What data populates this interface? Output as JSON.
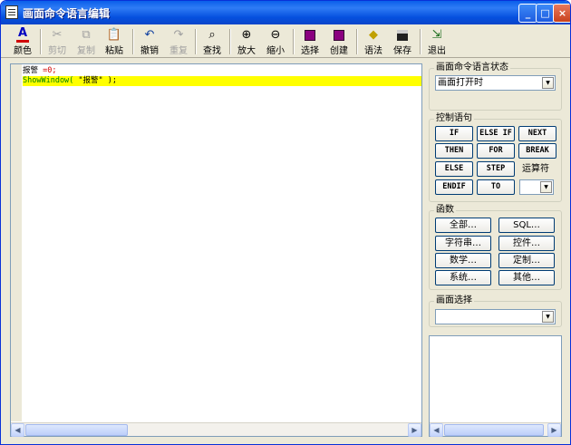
{
  "window": {
    "title": "画面命令语言编辑",
    "buttons": {
      "minimize": "_",
      "maximize": "□",
      "close": "×"
    }
  },
  "toolbar": {
    "color": "颜色",
    "cut": "剪切",
    "copy": "复制",
    "paste": "粘贴",
    "undo": "撤销",
    "redo": "重复",
    "find": "查找",
    "zoom_in": "放大",
    "zoom_out": "缩小",
    "select": "选择",
    "create": "创建",
    "syntax": "语法",
    "save": "保存",
    "exit": "退出"
  },
  "editor": {
    "lines": [
      {
        "parts": [
          "报警",
          " =0;"
        ]
      },
      {
        "parts": [
          "ShowWindow(",
          " \"报警\"",
          " );"
        ]
      }
    ]
  },
  "status_group": {
    "title": "画面命令语言状态",
    "selected": "画面打开时"
  },
  "control_group": {
    "title": "控制语句",
    "buttons": [
      "IF",
      "ELSE IF",
      "NEXT",
      "THEN",
      "FOR",
      "BREAK",
      "ELSE",
      "STEP",
      "ENDIF",
      "TO"
    ],
    "operator_label": "运算符",
    "operator_value": ""
  },
  "function_group": {
    "title": "函数",
    "buttons": [
      "全部…",
      "SQL…",
      "字符串…",
      "控件…",
      "数学…",
      "定制…",
      "系统…",
      "其他…"
    ]
  },
  "screen_group": {
    "title": "画面选择",
    "selected": ""
  },
  "colors": {
    "titlebar": "#0A5FEA",
    "highlight": "#FFFF00",
    "keyword_red": "#d00000",
    "keyword_green": "#008000"
  }
}
